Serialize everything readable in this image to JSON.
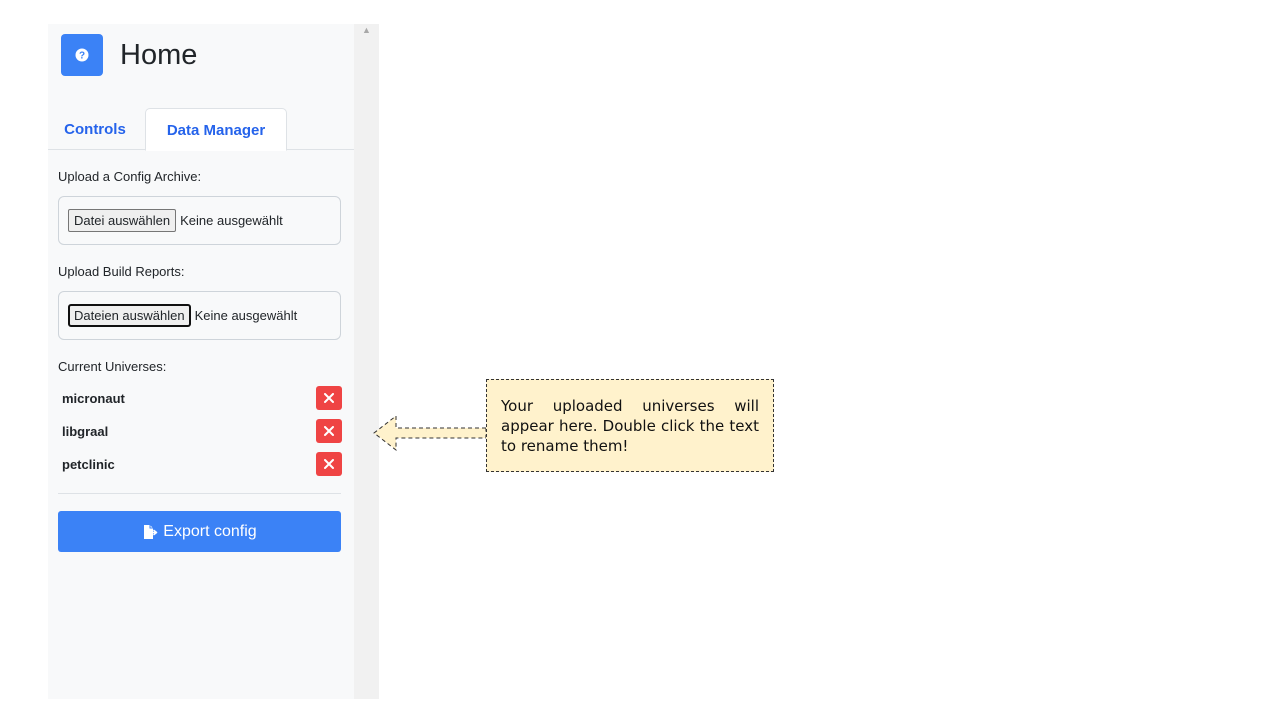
{
  "header": {
    "title": "Home",
    "logo_icon": "help-circle-icon",
    "accent_color": "#3b82f6"
  },
  "tabs": [
    {
      "label": "Controls",
      "active": false
    },
    {
      "label": "Data Manager",
      "active": true
    }
  ],
  "config_upload": {
    "label": "Upload a Config Archive:",
    "button_label": "Datei auswählen",
    "status": "Keine ausgewählt"
  },
  "reports_upload": {
    "label": "Upload Build Reports:",
    "button_label": "Dateien auswählen",
    "status": "Keine ausgewählt"
  },
  "universes": {
    "label": "Current Universes:",
    "items": [
      {
        "name": "micronaut"
      },
      {
        "name": "libgraal"
      },
      {
        "name": "petclinic"
      }
    ],
    "delete_icon": "close-icon",
    "delete_color": "#ef4444"
  },
  "export": {
    "label": "Export config",
    "icon": "file-export-icon"
  },
  "tooltip": {
    "text": "Your uploaded universes will appear here. Double click the text to rename them!",
    "background": "#fff2cc"
  }
}
